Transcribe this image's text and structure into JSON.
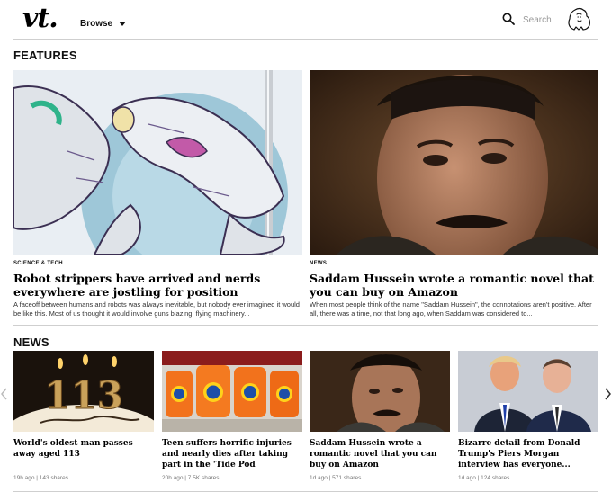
{
  "header": {
    "logo": "vt.",
    "browse_label": "Browse",
    "search_placeholder": "Search"
  },
  "features": {
    "heading": "FEATURES",
    "items": [
      {
        "category": "SCIENCE & TECH",
        "title": "Robot strippers have arrived and nerds everywhere are jostling for position",
        "excerpt": "A faceoff between humans and robots was always inevitable, but nobody ever imagined it would be like this. Most of us thought it would involve guns blazing, flying machinery..."
      },
      {
        "category": "NEWS",
        "title": "Saddam Hussein wrote a romantic novel that you can buy on Amazon",
        "excerpt": "When most people think of the name \"Saddam Hussein\", the connotations aren't positive. After all, there was a time, not that long ago, when Saddam was considered to..."
      }
    ]
  },
  "news": {
    "heading": "NEWS",
    "items": [
      {
        "title": "World's oldest man passes away aged 113",
        "meta": "19h ago | 143 shares"
      },
      {
        "title": "Teen suffers horrific injuries and nearly dies after taking part in the 'Tide Pod Challenge'",
        "meta": "20h ago | 7.5K shares"
      },
      {
        "title": "Saddam Hussein wrote a romantic novel that you can buy on Amazon",
        "meta": "1d ago | 571 shares"
      },
      {
        "title": "Bizarre detail from Donald Trump's Piers Morgan interview has everyone...",
        "meta": "1d ago | 124 shares"
      }
    ]
  },
  "images": {
    "cake_candles": "113"
  },
  "colors": {
    "divider": "#cfcfcf",
    "tide_orange": "#f2721c",
    "meta_gray": "#777777"
  }
}
